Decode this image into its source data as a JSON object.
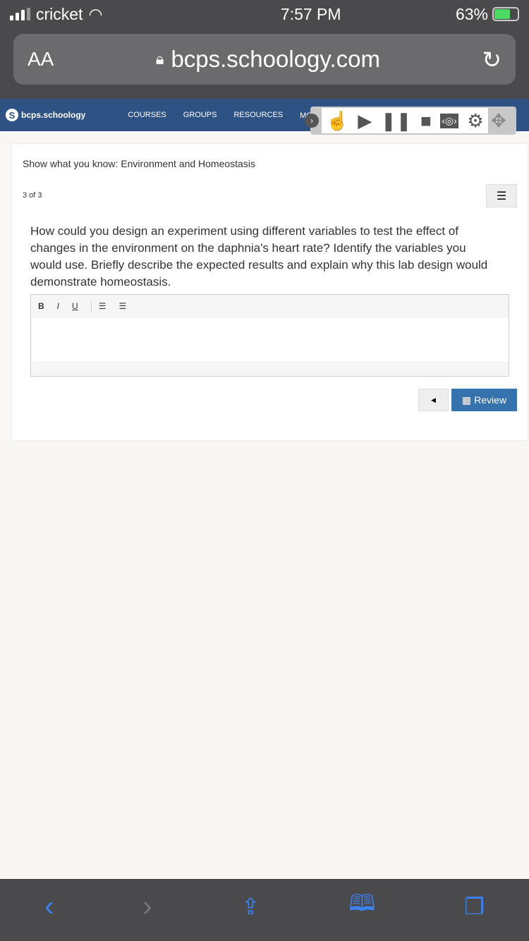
{
  "status": {
    "carrier": "cricket",
    "time": "7:57 PM",
    "battery": "63%"
  },
  "browser": {
    "text_size": "AA",
    "url": "bcps.schoology.com"
  },
  "nav": {
    "logo": "bcps.schoology",
    "items": [
      "COURSES",
      "GROUPS",
      "RESOURCES",
      "MORE ⋮"
    ]
  },
  "assessment": {
    "title": "Show what you know: Environment and Homeostasis",
    "counter": "3 of 3",
    "question": "How could you design an experiment using different variables to test the effect of changes in the environment on the daphnia's heart rate? Identify the variables you would use. Briefly describe the expected results and explain why this lab design would demonstrate homeostasis.",
    "editor": {
      "bold": "B",
      "italic": "I",
      "underline": "U",
      "value": ""
    },
    "review_label": "Review"
  },
  "colors": {
    "nav": "#2e5283",
    "button": "#3572ae"
  }
}
